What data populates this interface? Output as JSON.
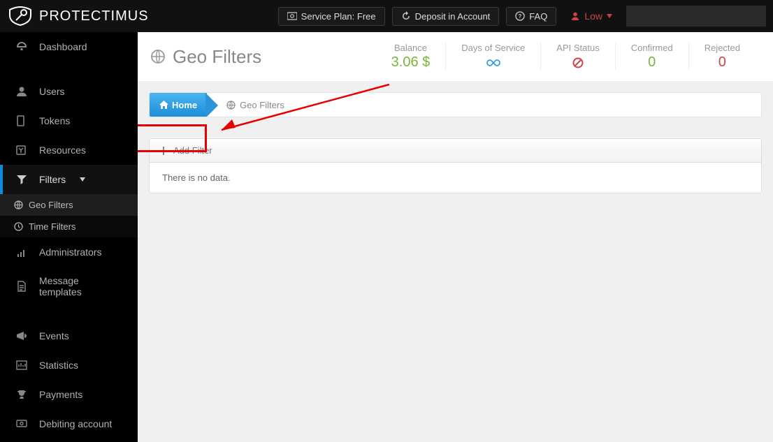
{
  "brand": "PROTECTIMUS",
  "topbar": {
    "service_plan": "Service Plan: Free",
    "deposit": "Deposit in Account",
    "faq": "FAQ",
    "user": "Low"
  },
  "sidebar": {
    "dashboard": "Dashboard",
    "users": "Users",
    "tokens": "Tokens",
    "resources": "Resources",
    "filters": "Filters",
    "geo_filters": "Geo Filters",
    "time_filters": "Time Filters",
    "administrators": "Administrators",
    "message_templates": "Message templates",
    "events": "Events",
    "statistics": "Statistics",
    "payments": "Payments",
    "debiting": "Debiting account"
  },
  "page": {
    "title": "Geo Filters"
  },
  "stats": {
    "balance_label": "Balance",
    "balance_value": "3.06 $",
    "days_label": "Days of Service",
    "api_label": "API Status",
    "confirmed_label": "Confirmed",
    "confirmed_value": "0",
    "rejected_label": "Rejected",
    "rejected_value": "0"
  },
  "breadcrumb": {
    "home": "Home",
    "geo_filters": "Geo Filters"
  },
  "panel": {
    "add_filter": "Add Filter",
    "no_data": "There is no data."
  }
}
